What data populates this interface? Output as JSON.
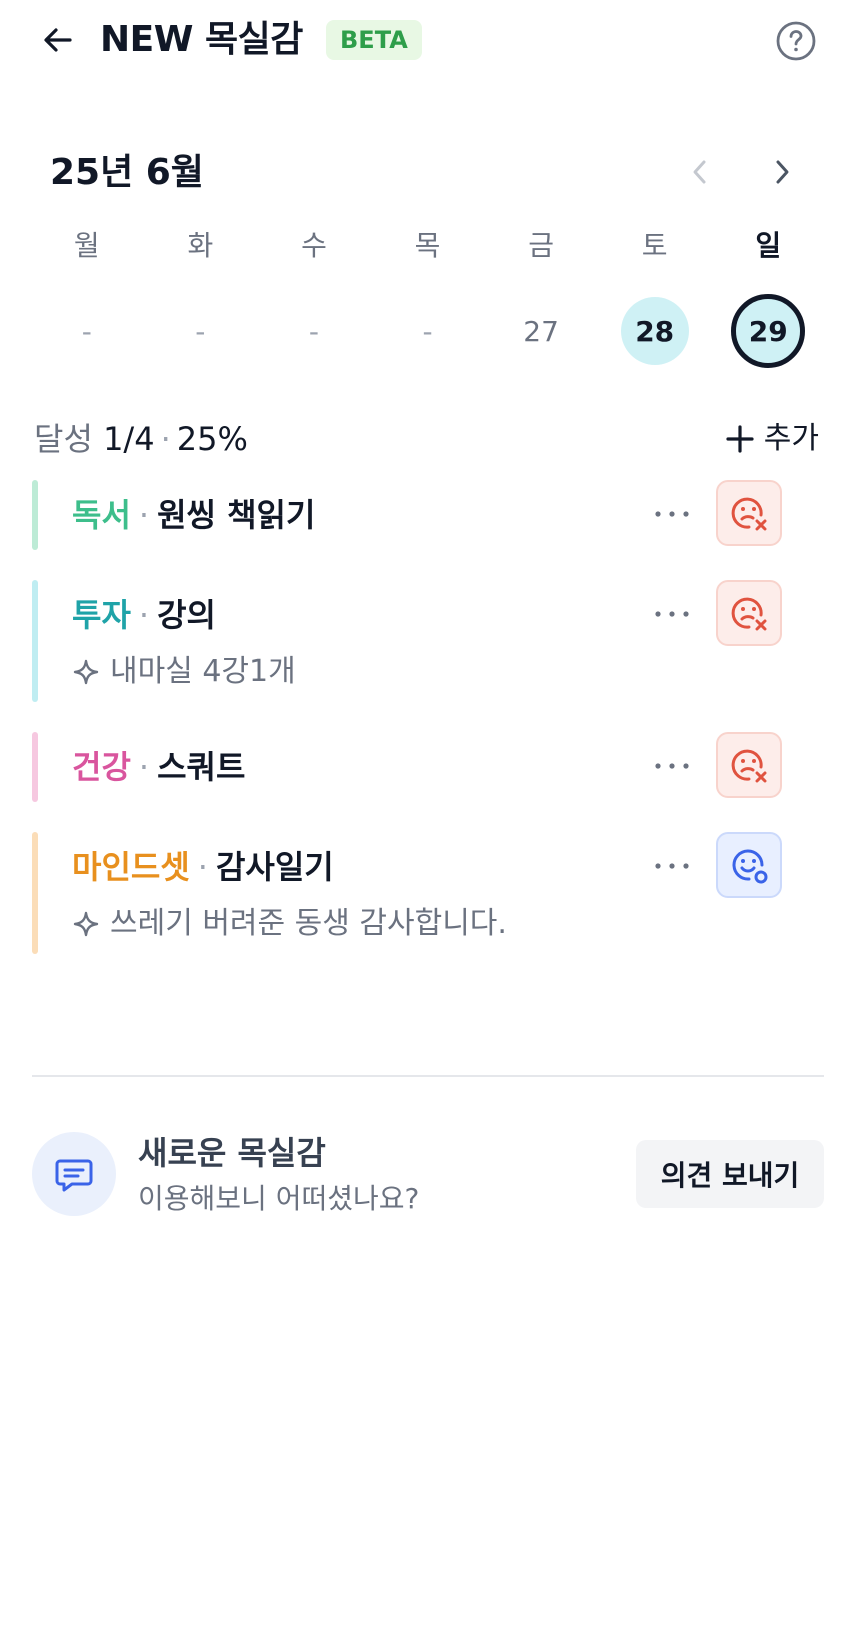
{
  "header": {
    "title": "NEW 목실감",
    "badge": "BETA",
    "back_icon": "arrow-left-icon",
    "help_icon": "question-circle-icon"
  },
  "calendar": {
    "month_label": "25년 6월",
    "weekdays": [
      "월",
      "화",
      "수",
      "목",
      "금",
      "토",
      "일"
    ],
    "dates": [
      "-",
      "-",
      "-",
      "-",
      "27",
      "28",
      "29"
    ]
  },
  "summary": {
    "label": "달성",
    "progress": "1/4",
    "sep": "·",
    "percent": "25%",
    "add_label": "추가"
  },
  "goals": [
    {
      "category": "독서",
      "dot": "·",
      "name": "원씽 책읽기",
      "note": "",
      "status": "fail"
    },
    {
      "category": "투자",
      "dot": "·",
      "name": "강의",
      "note": "내마실 4강1개",
      "status": "fail"
    },
    {
      "category": "건강",
      "dot": "·",
      "name": "스쿼트",
      "note": "",
      "status": "fail"
    },
    {
      "category": "마인드셋",
      "dot": "·",
      "name": "감사일기",
      "note": "쓰레기 버려준 동생 감사합니다.",
      "status": "done"
    }
  ],
  "colors": {
    "reading": "#3DBE8B",
    "investing": "#1FA3A8",
    "health": "#D9559E",
    "mindset": "#E8901E",
    "reading_bar": "#BDEBD6",
    "investing_bar": "#BFEDF2",
    "health_bar": "#F6C8E0",
    "mindset_bar": "#FBDDB8"
  },
  "feedback": {
    "title": "새로운 목실감",
    "subtitle": "이용해보니 어떠셨나요?",
    "button": "의견 보내기",
    "icon": "chat-icon"
  }
}
